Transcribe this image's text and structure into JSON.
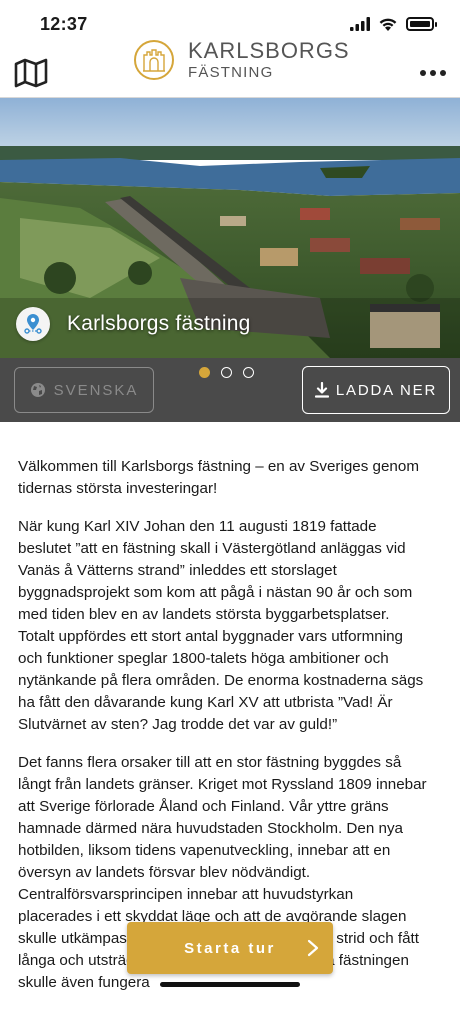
{
  "status_bar": {
    "time": "12:37"
  },
  "header": {
    "logo_line1": "KARLSBORGS",
    "logo_line2": "FÄSTNING",
    "icons": {
      "map": "map-icon",
      "more": "more-icon"
    }
  },
  "hero": {
    "title": "Karlsborgs fästning",
    "icon": "map-pin-icon",
    "slides_count": 3,
    "active_slide": 1
  },
  "controls": {
    "language_label": "SVENSKA",
    "download_label": "LADDA NER"
  },
  "article": {
    "paragraphs": [
      "Välkommen till Karlsborgs fästning – en av Sveriges genom tidernas största investeringar!",
      "När kung Karl XIV Johan den 11 augusti 1819 fattade beslutet ”att en fästning skall i Västergötland anläggas vid Vanäs å Vätterns strand” inleddes ett storslaget byggnadsprojekt som kom att pågå i nästan 90 år och som med tiden blev en av landets största byggarbetsplatser. Totalt uppfördes ett stort antal byggnader vars utformning och funktioner speglar 1800-talets höga ambitioner och nytänkande på flera områden. De enorma kostnaderna sägs ha fått den dåvarande kung Karl XV att utbrista ”Vad! Är Slutvärnet av sten? Jag trodde det var av guld!”",
      "Det fanns flera orsaker till att en stor fästning byggdes så långt från landets gränser. Kriget mot Ryssland 1809 innebar att Sverige förlorade Åland och Finland. Vår yttre gräns hamnade därmed nära huvudstaden Stockholm. Den nya hotbilden, liksom tidens vapenutveckling, innebar att en översyn av landets försvar blev nödvändigt. Centralförsvarsprincipen innebar att huvudstyrkan placerades i ett skyddat läge och att de avgörande slagen skulle utkämpas när fienden redan försvagats i strid och fått långa och utsträckta försörjningsleder. Den nya fästningen skulle även fungera"
    ]
  },
  "start_tour": {
    "label": "Starta tur",
    "icon": "chevron-right-icon"
  },
  "colors": {
    "accent": "#d5a63a",
    "controls_bg": "#4a4a4a"
  }
}
